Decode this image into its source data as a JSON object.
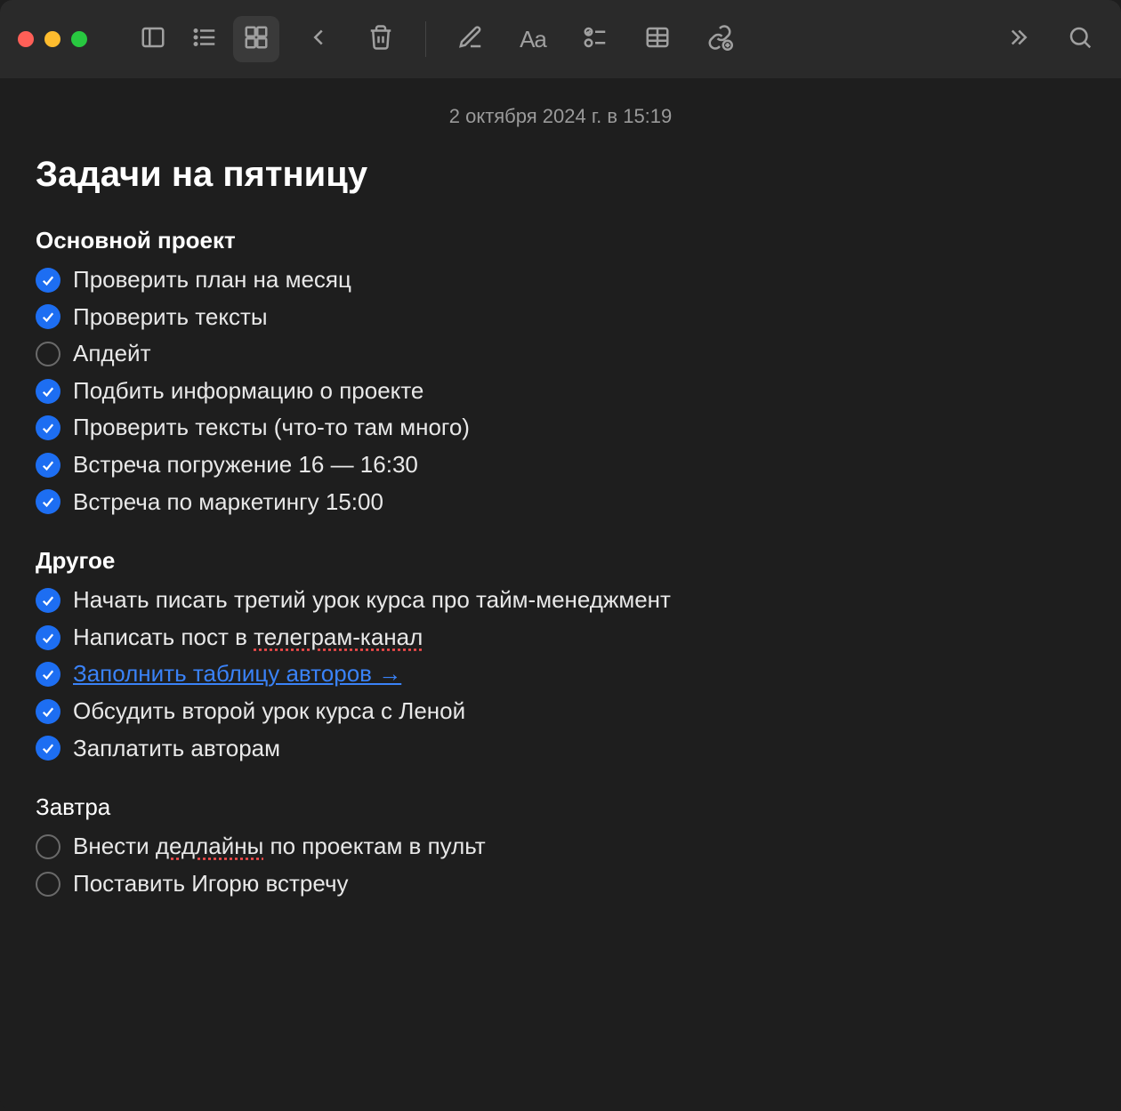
{
  "timestamp": "2 октября 2024 г. в 15:19",
  "title": "Задачи на пятницу",
  "sections": [
    {
      "heading": "Основной проект",
      "headingBold": true,
      "items": [
        {
          "done": true,
          "text": "Проверить план на месяц"
        },
        {
          "done": true,
          "text": "Проверить тексты"
        },
        {
          "done": false,
          "text": "Апдейт"
        },
        {
          "done": true,
          "text": "Подбить информацию о проекте"
        },
        {
          "done": true,
          "text": "Проверить тексты (что-то там много)"
        },
        {
          "done": true,
          "text": "Встреча погружение  16 — 16:30"
        },
        {
          "done": true,
          "text": "Встреча по маркетингу 15:00"
        }
      ]
    },
    {
      "heading": "Другое",
      "headingBold": true,
      "items": [
        {
          "done": true,
          "text": "Начать писать третий урок курса про тайм-менеджмент"
        },
        {
          "done": true,
          "prefix": "Написать пост в ",
          "spell": "телеграм-канал"
        },
        {
          "done": true,
          "link": "Заполнить таблицу авторов →"
        },
        {
          "done": true,
          "text": "Обсудить второй урок курса с Леной"
        },
        {
          "done": true,
          "text": "Заплатить авторам"
        }
      ]
    },
    {
      "heading": "Завтра",
      "headingBold": false,
      "items": [
        {
          "done": false,
          "prefix": "Внести ",
          "spell": "дедлайны",
          "suffix": " по проектам в пульт"
        },
        {
          "done": false,
          "text": "Поставить Игорю встречу"
        }
      ]
    }
  ]
}
